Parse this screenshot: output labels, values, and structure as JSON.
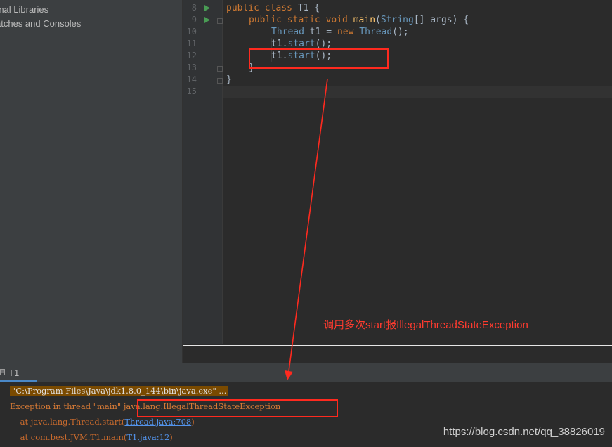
{
  "sidebar": {
    "items": [
      {
        "label": "rnal Libraries"
      },
      {
        "label": "atches and Consoles"
      }
    ]
  },
  "editor": {
    "lines": [
      {
        "num": "8"
      },
      {
        "num": "9"
      },
      {
        "num": "10"
      },
      {
        "num": "11"
      },
      {
        "num": "12"
      },
      {
        "num": "13"
      },
      {
        "num": "14"
      },
      {
        "num": "15"
      }
    ],
    "code": {
      "l8_kw": "public class ",
      "l8_name": "T1",
      "l8_rest": " {",
      "l9_kw": "public static void ",
      "l9_fn": "main",
      "l9_p1": "(",
      "l9_type": "String",
      "l9_rest": "[] args) {",
      "l10_type": "Thread",
      "l10_mid": " t1 = ",
      "l10_new": "new ",
      "l10_type2": "Thread",
      "l10_rest": "();",
      "l11_obj": "t1.",
      "l11_fn": "start",
      "l11_rest": "();",
      "l12_obj": "t1.",
      "l12_fn": "start",
      "l12_rest": "();",
      "l13": "}",
      "l14": "}"
    }
  },
  "run_panel": {
    "tab_label": "T1",
    "console": {
      "cmd": "\"C:\\Program Files\\Java\\jdk1.8.0_144\\bin\\java.exe\" ...",
      "exception_prefix": "Exception in thread \"main\" ",
      "exception_class": "java.lang.IllegalThreadStateException",
      "stack1_text": "    at java.lang.Thread.start(",
      "stack1_link": "Thread.java:708",
      "stack1_end": ")",
      "stack2_text": "    at com.best.JVM.T1.main(",
      "stack2_link": "T1.java:12",
      "stack2_end": ")"
    }
  },
  "annotation": {
    "text": "调用多次start报IllegalThreadStateException"
  },
  "watermark": {
    "text": "https://blog.csdn.net/qq_38826019"
  },
  "colors": {
    "accent_red": "#ff3b2f",
    "keyword": "#cc7832",
    "link": "#5394ec"
  }
}
